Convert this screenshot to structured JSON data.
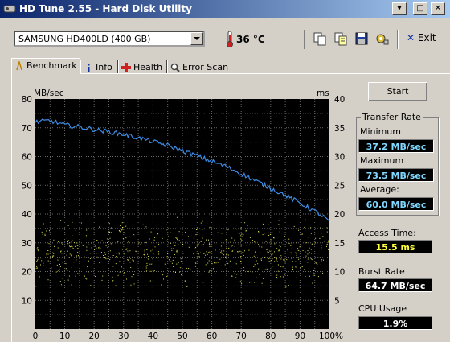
{
  "window": {
    "title": "HD Tune 2.55 - Hard Disk Utility",
    "buttons": {
      "minimize": "▾",
      "maximize": "□",
      "close": "✕"
    }
  },
  "toolbar": {
    "drive": "SAMSUNG HD400LD (400 GB)",
    "temperature": "36 °C",
    "exit_label": "Exit",
    "tools": [
      "copy-icon",
      "copy-info-icon",
      "save-icon",
      "options-icon"
    ]
  },
  "tabs": [
    {
      "label": "Benchmark",
      "icon": "benchmark-icon",
      "active": true
    },
    {
      "label": "Info",
      "icon": "info-icon",
      "active": false
    },
    {
      "label": "Health",
      "icon": "health-icon",
      "active": false
    },
    {
      "label": "Error Scan",
      "icon": "error-scan-icon",
      "active": false
    }
  ],
  "benchmark": {
    "start_label": "Start",
    "transfer_rate": {
      "title": "Transfer Rate",
      "minimum_label": "Minimum",
      "minimum": "37.2 MB/sec",
      "maximum_label": "Maximum",
      "maximum": "73.5 MB/sec",
      "average_label": "Average:",
      "average": "60.0 MB/sec"
    },
    "access_time_label": "Access Time:",
    "access_time": "15.5 ms",
    "burst_rate_label": "Burst Rate",
    "burst_rate": "64.7 MB/sec",
    "cpu_usage_label": "CPU Usage",
    "cpu_usage": "1.9%"
  },
  "colors": {
    "plot_bg": "#000000",
    "grid": "#6a6a6a",
    "transfer_line": "#3c8ce6",
    "access_dots": "#e6e64a",
    "value_blue": "#7fd8ff",
    "value_yellow": "#ffff40"
  },
  "chart_data": {
    "type": "line",
    "left_axis_label": "MB/sec",
    "right_axis_label": "ms",
    "left_ylim": [
      0,
      80
    ],
    "right_ylim": [
      0,
      40
    ],
    "left_ticks": [
      "80",
      "70",
      "60",
      "50",
      "40",
      "30",
      "20",
      "10"
    ],
    "right_ticks": [
      "40",
      "35",
      "30",
      "25",
      "20",
      "15",
      "10",
      "5"
    ],
    "x_ticks": [
      "0",
      "10",
      "20",
      "30",
      "40",
      "50",
      "60",
      "70",
      "80",
      "90",
      "100%"
    ],
    "xlim": [
      0,
      100
    ],
    "grid": true,
    "series": [
      {
        "axis": "left",
        "x": [
          0,
          5,
          10,
          15,
          20,
          25,
          30,
          35,
          40,
          45,
          50,
          55,
          60,
          65,
          70,
          75,
          80,
          85,
          90,
          95,
          98,
          100
        ],
        "values": [
          72,
          72.5,
          71,
          70.3,
          69.4,
          68.6,
          67.7,
          66.5,
          65.2,
          63.8,
          62,
          60.3,
          58.3,
          56.5,
          54,
          51.5,
          49,
          46.5,
          43.8,
          41,
          39,
          37.5
        ]
      },
      {
        "axis": "right",
        "type": "scatter",
        "description_of_spread": "access time samples",
        "band_ms": [
          8,
          20
        ]
      }
    ]
  }
}
